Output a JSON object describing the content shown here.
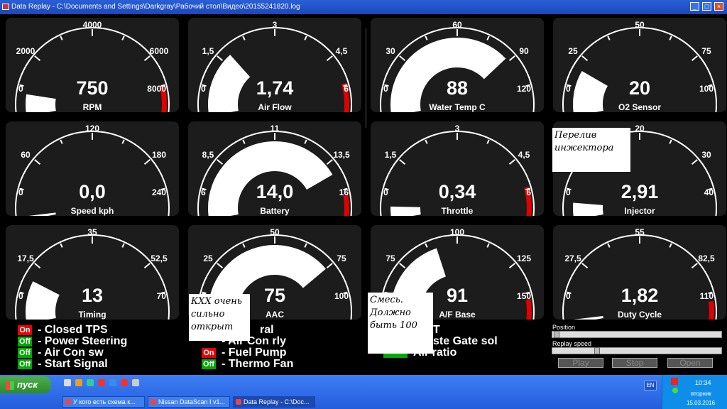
{
  "window": {
    "title": "Data Replay - C:\\Documents and Settings\\Darkgray\\Рабочий стол\\Видео\\20155241820.log"
  },
  "gauges": [
    {
      "name": "RPM",
      "value": "750",
      "labels": [
        "0",
        "2000",
        "4000",
        "6000",
        "8000"
      ],
      "min": 0,
      "max": 8000,
      "current": 750,
      "redline": 7000,
      "has_red": true
    },
    {
      "name": "Air Flow",
      "value": "1,74",
      "labels": [
        "0",
        "1,5",
        "3",
        "4,5",
        "6"
      ],
      "min": 0,
      "max": 6,
      "current": 1.74,
      "redline": 5.2,
      "has_red": true
    },
    {
      "name": "Water Temp C",
      "value": "88",
      "labels": [
        "0",
        "30",
        "60",
        "90",
        "120"
      ],
      "min": 0,
      "max": 120,
      "current": 88,
      "redline": 105,
      "has_red": false
    },
    {
      "name": "O2 Sensor",
      "value": "20",
      "labels": [
        "0",
        "25",
        "50",
        "75",
        "100"
      ],
      "min": 0,
      "max": 100,
      "current": 20,
      "redline": 85,
      "has_red": false
    },
    {
      "name": "Speed kph",
      "value": "0,0",
      "labels": [
        "0",
        "60",
        "120",
        "180",
        "240"
      ],
      "min": 0,
      "max": 240,
      "current": 0,
      "redline": 210,
      "has_red": false
    },
    {
      "name": "Battery",
      "value": "14,0",
      "labels": [
        "6",
        "8,5",
        "11",
        "13,5",
        "16"
      ],
      "min": 6,
      "max": 16,
      "current": 14,
      "redline": 15,
      "has_red": true
    },
    {
      "name": "Throttle",
      "value": "0,34",
      "labels": [
        "0",
        "1,5",
        "3",
        "4,5",
        "6"
      ],
      "min": 0,
      "max": 6,
      "current": 0.34,
      "redline": 5.2,
      "has_red": true
    },
    {
      "name": "Injector",
      "value": "2,91",
      "labels": [
        "0",
        "10",
        "20",
        "30",
        "40"
      ],
      "min": 0,
      "max": 40,
      "current": 2.91,
      "redline": 35,
      "has_red": false
    },
    {
      "name": "Timing",
      "value": "13",
      "labels": [
        "0",
        "17,5",
        "35",
        "52,5",
        "70"
      ],
      "min": 0,
      "max": 70,
      "current": 13,
      "redline": 60,
      "has_red": false
    },
    {
      "name": "AAC",
      "value": "75",
      "labels": [
        "0",
        "25",
        "50",
        "75",
        "100"
      ],
      "min": 0,
      "max": 100,
      "current": 75,
      "redline": 88,
      "has_red": false
    },
    {
      "name": "A/F Base",
      "value": "91",
      "labels": [
        "0",
        "75",
        "100",
        "125",
        "150"
      ],
      "min": 50,
      "max": 150,
      "current": 91,
      "redline": 140,
      "has_red": true
    },
    {
      "name": "Duty Cycle",
      "value": "1,82",
      "labels": [
        "0",
        "27,5",
        "55",
        "82,5",
        "110"
      ],
      "min": 0,
      "max": 110,
      "current": 1.82,
      "redline": 100,
      "has_red": true
    }
  ],
  "status_left": [
    {
      "state": "On",
      "label": "- Closed TPS"
    },
    {
      "state": "Off",
      "label": "- Power Steering"
    },
    {
      "state": "Off",
      "label": "- Air Con sw"
    },
    {
      "state": "Off",
      "label": "- Start Signal"
    }
  ],
  "status_mid": [
    {
      "state": "",
      "label": "ral"
    },
    {
      "state": "",
      "label": "- Air Con rly"
    },
    {
      "state": "On",
      "label": "- Fuel Pump"
    },
    {
      "state": "Off",
      "label": "- Thermo Fan"
    }
  ],
  "status_right": [
    {
      "label": "T"
    },
    {
      "label": "ste Gate sol"
    },
    {
      "label": "Air ratio"
    }
  ],
  "notes": {
    "injector": "Перелив\nинжектора",
    "aac": "КХХ очень\nсильно\nоткрыт",
    "afbase": "Смесь.\nДолжно\nбыть 100"
  },
  "controls": {
    "position_label": "Position",
    "position_level": 0,
    "replay_speed_label": "Replay speed",
    "replay_speed_level": 0.25,
    "play": "Play",
    "stop": "Stop",
    "open": "Open"
  },
  "taskbar": {
    "start": "пуск",
    "tasks": [
      "У кого есть схема к...",
      "Nissan DataScan I v1...",
      "Data Replay - C:\\Doc..."
    ],
    "lang": "EN",
    "time": "10:34",
    "weekday": "вторник",
    "date": "15.03.2016"
  },
  "colors": {
    "gauge_bg": "#1c1c1c",
    "redline": "#e00000",
    "status_on": "#e00000",
    "status_off": "#00a000",
    "taskbar": "#245ddb"
  }
}
